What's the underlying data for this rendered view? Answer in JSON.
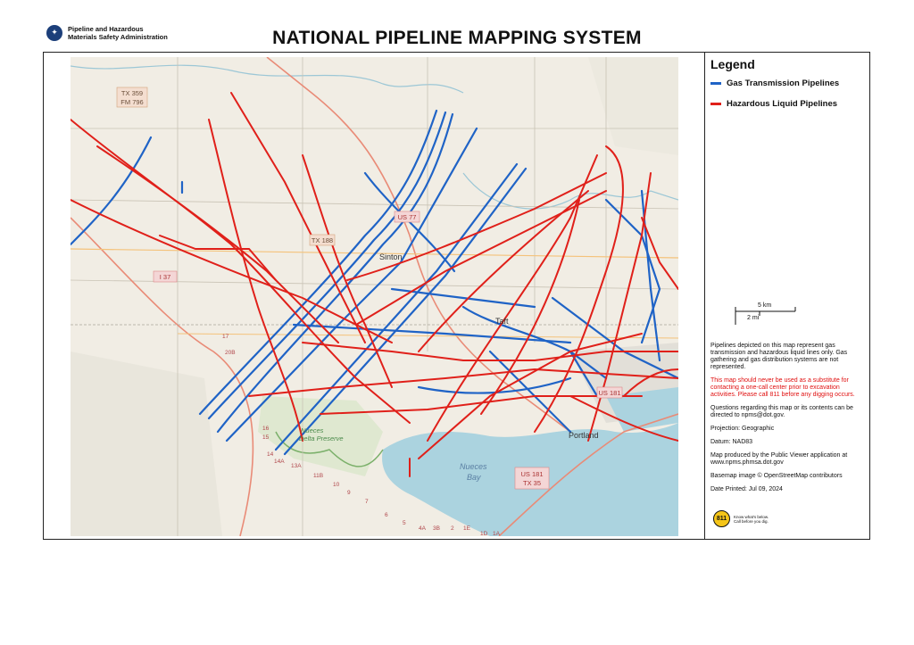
{
  "agency": {
    "line1": "Pipeline and Hazardous",
    "line2": "Materials Safety Administration",
    "seal_glyph": "✦"
  },
  "title": "NATIONAL PIPELINE MAPPING SYSTEM",
  "legend": {
    "title": "Legend",
    "items": [
      {
        "label": "Gas Transmission Pipelines",
        "color": "#1f63c6"
      },
      {
        "label": "Hazardous Liquid Pipelines",
        "color": "#e0201a"
      }
    ]
  },
  "scale": {
    "km": "5 km",
    "mi": "2 mi"
  },
  "notes": {
    "disclaimer": "Pipelines depicted on this map represent gas transmission and hazardous liquid lines only. Gas gathering and gas distribution systems are not represented.",
    "warning": "This map should never be used as a substitute for contacting a one-call center prior to excavation activities. Please call 811 before any digging occurs.",
    "questions": "Questions regarding this map or its contents can be directed to npms@dot.gov.",
    "projection": "Projection: Geographic",
    "datum": "Datum: NAD83",
    "produced": "Map produced by the Public Viewer application at www.npms.phmsa.dot.gov",
    "basemap": "Basemap image © OpenStreetMap contributors",
    "date": "Date Printed: Jul 09, 2024"
  },
  "badge": {
    "number": "811",
    "line1": "Know what's below.",
    "line2": "Call before you dig."
  },
  "map": {
    "places": [
      "Sinton",
      "Taft",
      "Portland",
      "Nueces Bay",
      "Nueces Delta Preserve"
    ],
    "road_shields": [
      "TX 359",
      "FM 796",
      "US 77",
      "I 37",
      "US 181",
      "US 181 TX 35",
      "TX 188"
    ],
    "exits": [
      "16",
      "15",
      "14",
      "14A",
      "13A",
      "11B",
      "10",
      "9",
      "7",
      "6",
      "5",
      "4A",
      "3B",
      "2",
      "1E",
      "1D",
      "1A",
      "20B",
      "17"
    ],
    "colors": {
      "land": "#f1ede4",
      "water": "#abd3df",
      "field": "#e4e2d5",
      "wetland": "#d8e8c8"
    }
  }
}
